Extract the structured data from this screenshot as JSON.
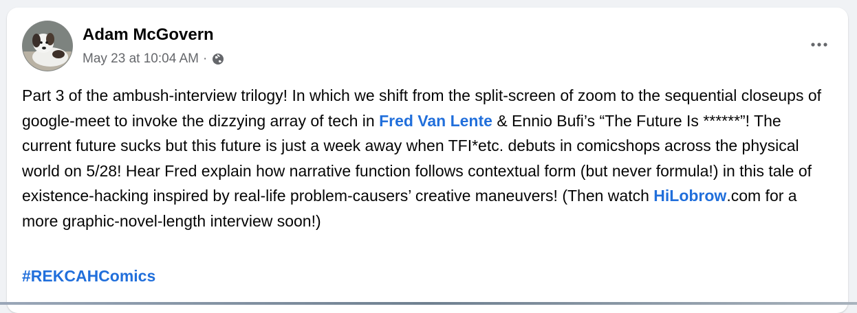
{
  "post": {
    "author": "Adam McGovern",
    "timestamp": "May 23 at 10:04 AM",
    "separator": "·",
    "audience_icon": "globe-icon",
    "more_icon": "more-options-icon",
    "text_parts": {
      "p1": "Part 3 of the ambush-interview trilogy! In which we shift from the split-screen of zoom to the sequential closeups of google-meet to invoke the dizzying array of tech in ",
      "link1": "Fred Van Lente",
      "p2": " & Ennio Bufi’s “The Future Is ******”! The current future sucks but this future is just a week away when TFI*etc. debuts in comicshops across the physical world on 5/28! Hear Fred explain how narrative function follows contextual form (but never formula!) in this tale of existence-hacking inspired by real-life problem-causers’ creative maneuvers! (Then watch ",
      "link2": "HiLobrow",
      "p3": ".com for a more graphic-novel-length interview soon!)"
    },
    "hashtag": "#REKCAHComics"
  },
  "colors": {
    "link": "#216fdb",
    "meta_text": "#65676b",
    "page_bg": "#f0f2f5"
  }
}
